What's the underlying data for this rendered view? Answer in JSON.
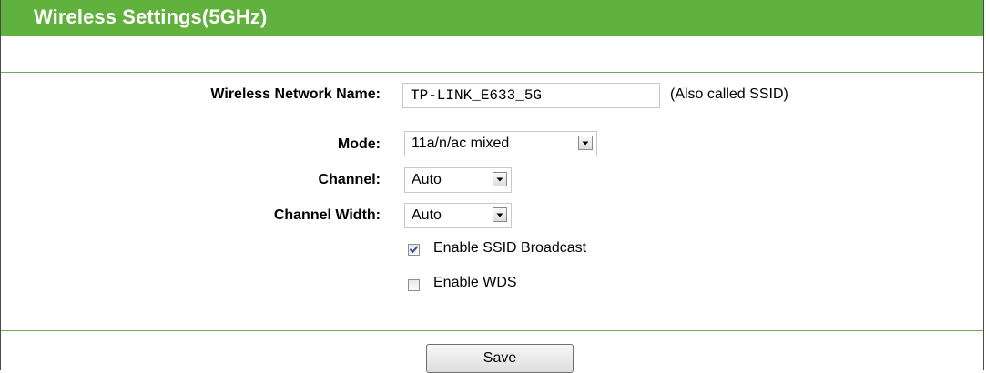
{
  "header": {
    "title": "Wireless Settings(5GHz)",
    "color": "#60b13d"
  },
  "form": {
    "network_name": {
      "label": "Wireless Network Name:",
      "value": "TP-LINK_E633_5G",
      "hint": "(Also called SSID)"
    },
    "mode": {
      "label": "Mode:",
      "selected": "11a/n/ac mixed",
      "icon": "chevron-down-icon"
    },
    "channel": {
      "label": "Channel:",
      "selected": "Auto",
      "icon": "chevron-down-icon"
    },
    "channel_width": {
      "label": "Channel Width:",
      "selected": "Auto",
      "icon": "chevron-down-icon"
    },
    "ssid_broadcast": {
      "label": "Enable SSID Broadcast",
      "checked": true,
      "icon": "checkmark-icon"
    },
    "wds": {
      "label": "Enable WDS",
      "checked": false
    }
  },
  "actions": {
    "save_label": "Save"
  },
  "colors": {
    "accent_green": "#60b13d",
    "rule_green": "#6aaa5a",
    "check_blue": "#2a4f9f"
  }
}
